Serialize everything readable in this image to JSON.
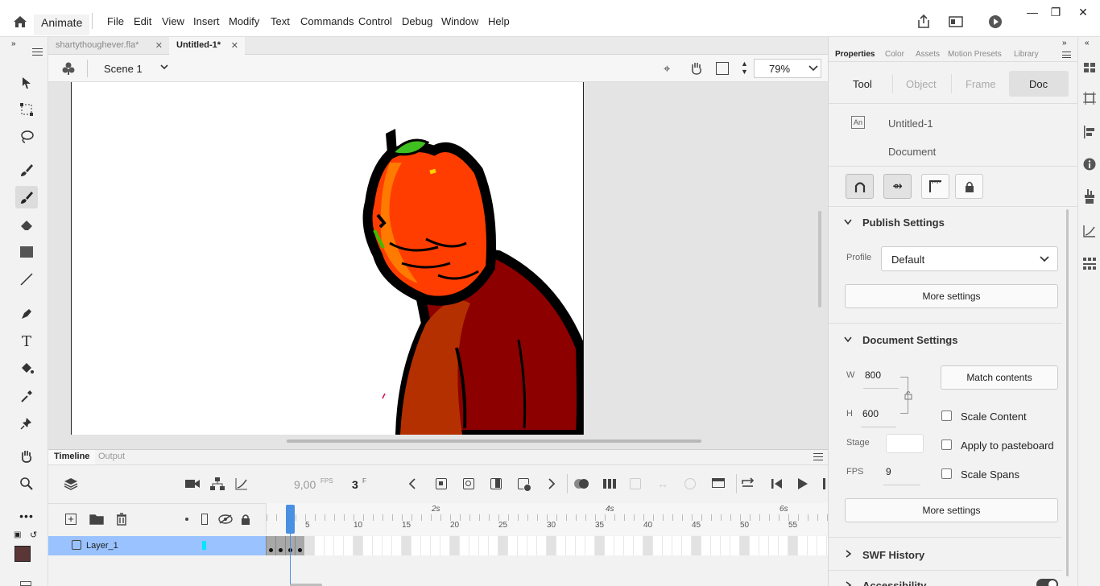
{
  "app": {
    "name": "Animate"
  },
  "menu": [
    "File",
    "Edit",
    "View",
    "Insert",
    "Modify",
    "Text",
    "Commands",
    "Control",
    "Debug",
    "Window",
    "Help"
  ],
  "tabs": [
    {
      "label": "shartythoughever.fla*",
      "active": false
    },
    {
      "label": "Untitled-1*",
      "active": true
    }
  ],
  "scene": {
    "name": "Scene 1",
    "zoom": "79%"
  },
  "timeline": {
    "tabs": [
      "Timeline",
      "Output"
    ],
    "fps": "9,00",
    "fps_unit": "FPS",
    "frame": "3",
    "frame_unit": "F",
    "time_marks": [
      "2s",
      "4s",
      "6s"
    ],
    "frame_numbers": [
      "5",
      "10",
      "15",
      "20",
      "25",
      "30",
      "35",
      "40",
      "45",
      "50",
      "55"
    ],
    "layer": "Layer_1",
    "layer_color": "#00e5ff"
  },
  "properties": {
    "panel_tabs": [
      "Properties",
      "Color",
      "Assets",
      "Motion Presets",
      "Library"
    ],
    "mode_tabs": [
      "Tool",
      "Object",
      "Frame",
      "Doc"
    ],
    "active_mode": "Doc",
    "doc_icon_text": "An",
    "doc_name": "Untitled-1",
    "doc_type": "Document",
    "publish": {
      "title": "Publish Settings",
      "profile_label": "Profile",
      "profile_value": "Default",
      "more": "More settings"
    },
    "document": {
      "title": "Document Settings",
      "w_label": "W",
      "w": "800",
      "h_label": "H",
      "h": "600",
      "match": "Match contents",
      "scale_content": "Scale Content",
      "stage_label": "Stage",
      "apply_pasteboard": "Apply to pasteboard",
      "fps_label": "FPS",
      "fps": "9",
      "scale_spans": "Scale Spans",
      "more": "More settings"
    },
    "swf_history": "SWF History",
    "accessibility": "Accessibility"
  },
  "colors": {
    "stroke": "#5a3636",
    "fill": "#ffffff",
    "accent": "#99c2ff",
    "playhead": "#4a90e2"
  }
}
